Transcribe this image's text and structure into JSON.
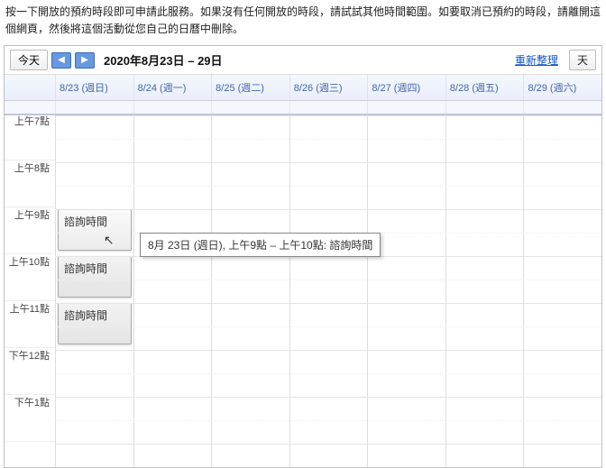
{
  "instructions": "按一下開放的預約時段即可申請此服務。如果沒有任何開放的時段，請試試其他時間範圍。如要取消已預約的時段，請離開這個網頁，然後將這個活動從您自己的日曆中刪除。",
  "toolbar": {
    "today": "今天",
    "prev_icon": "◀",
    "next_icon": "▶",
    "date_range": "2020年8月23日 – 29日",
    "refresh": "重新整理",
    "view_day": "天"
  },
  "days": [
    {
      "label": "8/23 (週日)"
    },
    {
      "label": "8/24 (週一)"
    },
    {
      "label": "8/25 (週二)"
    },
    {
      "label": "8/26 (週三)"
    },
    {
      "label": "8/27 (週四)"
    },
    {
      "label": "8/28 (週五)"
    },
    {
      "label": "8/29 (週六)"
    }
  ],
  "time_labels": [
    "上午7點",
    "上午8點",
    "上午9點",
    "上午10點",
    "上午11點",
    "下午12點",
    "下午1點"
  ],
  "events": [
    {
      "label": "諮詢時間"
    },
    {
      "label": "諮詢時間"
    },
    {
      "label": "諮詢時間"
    }
  ],
  "tooltip": "8月 23日 (週日), 上午9點 – 上午10點: 諮詢時間"
}
